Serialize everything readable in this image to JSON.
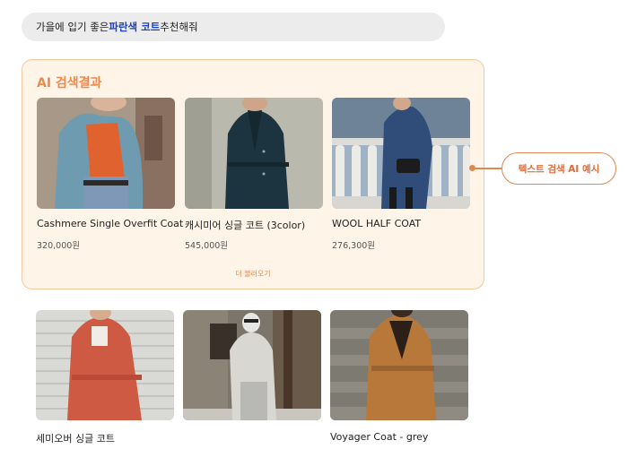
{
  "search": {
    "query_prefix": "가을에 입기 좋은 ",
    "query_highlight": "파란색 코트",
    "query_suffix": " 추천해줘"
  },
  "ai_results": {
    "title": "AI 검색결과",
    "more_label": "더 불러오기",
    "items": [
      {
        "name": "Cashmere Single Overfit Coat",
        "price": "320,000원"
      },
      {
        "name": "캐시미어 싱글 코트 (3color)",
        "price": "545,000원"
      },
      {
        "name": "WOOL HALF COAT",
        "price": "276,300원"
      }
    ]
  },
  "callout": {
    "label": "텍스트 검색 AI 예시"
  },
  "more_results": {
    "items": [
      {
        "name": "세미오버 싱글 코트"
      },
      {
        "name": ""
      },
      {
        "name": "Voyager Coat - grey"
      }
    ]
  },
  "colors": {
    "accent": "#ee8a4e",
    "highlight": "#1a3fc4",
    "panel_bg": "#fff4e8"
  }
}
